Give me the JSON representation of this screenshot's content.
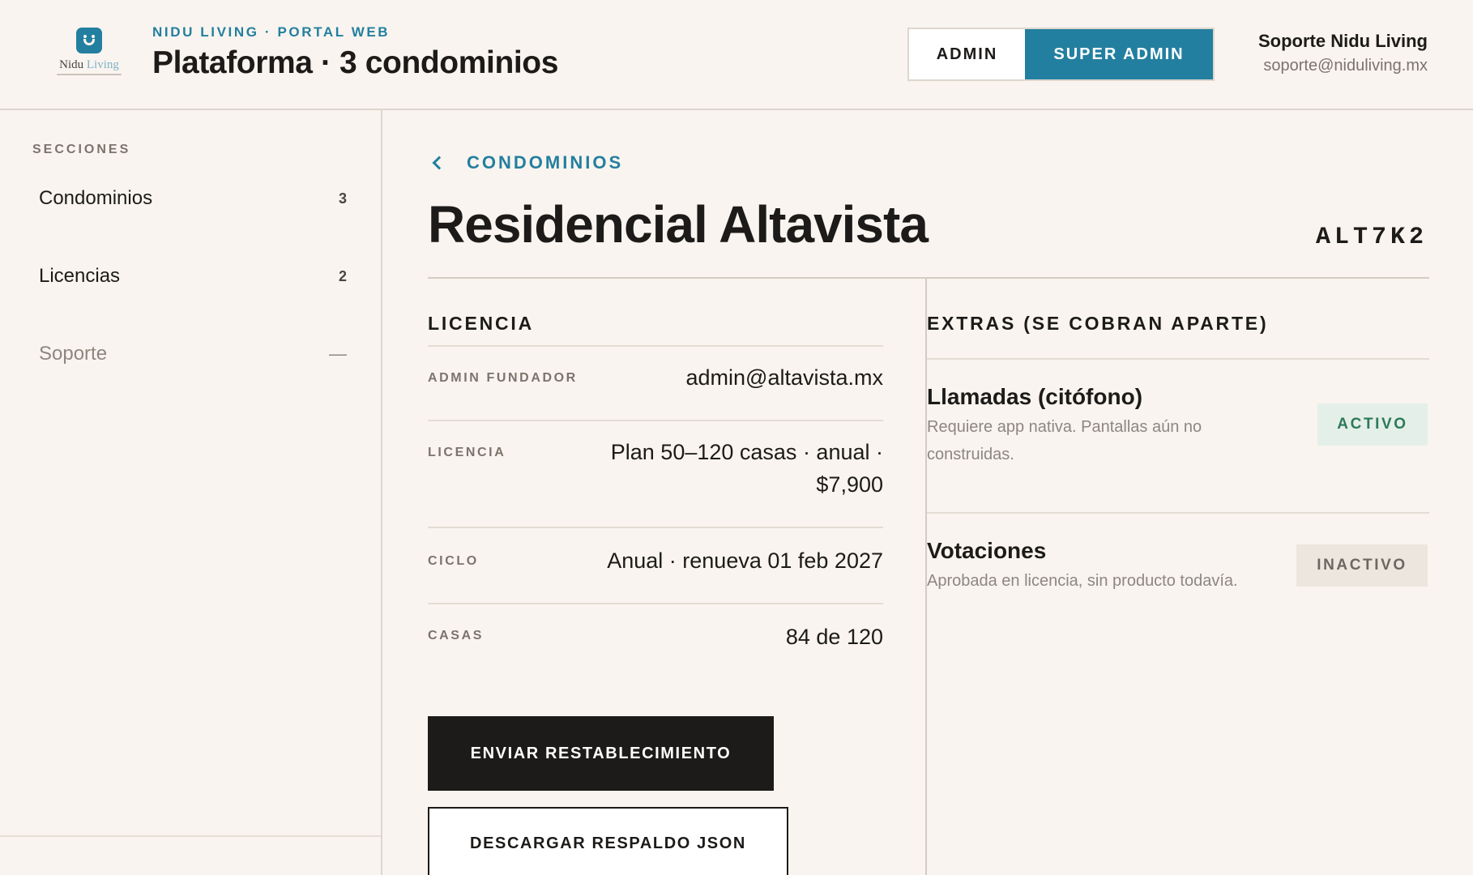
{
  "header": {
    "logo": {
      "word_main": "Nidu",
      "word_accent": "Living"
    },
    "eyebrow": "NIDU LIVING · PORTAL WEB",
    "title": "Plataforma · 3 condominios",
    "roles": {
      "admin": "ADMIN",
      "super_admin": "SUPER ADMIN",
      "active": "super_admin"
    },
    "user": {
      "name": "Soporte Nidu Living",
      "email": "soporte@niduliving.mx"
    }
  },
  "sidebar": {
    "heading": "SECCIONES",
    "items": [
      {
        "label": "Condominios",
        "count": "3",
        "enabled": true
      },
      {
        "label": "Licencias",
        "count": "2",
        "enabled": true
      },
      {
        "label": "Soporte",
        "count": "—",
        "enabled": false
      }
    ]
  },
  "main": {
    "breadcrumb": "CONDOMINIOS",
    "title": "Residencial Altavista",
    "code": "ALT7K2",
    "license": {
      "section_title": "LICENCIA",
      "rows": [
        {
          "key": "ADMIN FUNDADOR",
          "value_lines": [
            "admin@altavista.mx"
          ]
        },
        {
          "key": "LICENCIA",
          "value_lines": [
            "Plan 50–120 casas · anual ·",
            "$7,900"
          ]
        },
        {
          "key": "CICLO",
          "value_lines": [
            "Anual · renueva 01 feb 2027"
          ]
        },
        {
          "key": "CASAS",
          "value_lines": [
            "84 de 120"
          ]
        }
      ],
      "primary_button": "ENVIAR RESTABLECIMIENTO",
      "secondary_button": "DESCARGAR RESPALDO JSON"
    },
    "extras": {
      "section_title": "EXTRAS (SE COBRAN APARTE)",
      "items": [
        {
          "name": "Llamadas (citófono)",
          "desc_lines": [
            "Requiere app nativa. Pantallas aún no",
            "construidas."
          ],
          "status": "ACTIVO",
          "active": true
        },
        {
          "name": "Votaciones",
          "desc_lines": [
            "Aprobada en licencia, sin producto todavía."
          ],
          "status": "INACTIVO",
          "active": false
        }
      ]
    }
  },
  "colors": {
    "background": "#f9f4ef",
    "accent": "#237f9f",
    "text": "#1d1b19",
    "muted": "#7b746d",
    "active_badge_bg": "#e5efe9",
    "active_badge_text": "#2c7a5a",
    "inactive_badge_bg": "#ece6de"
  },
  "icons": {
    "logo": "nidu-living-logo",
    "breadcrumb": "chevron-left-icon"
  }
}
